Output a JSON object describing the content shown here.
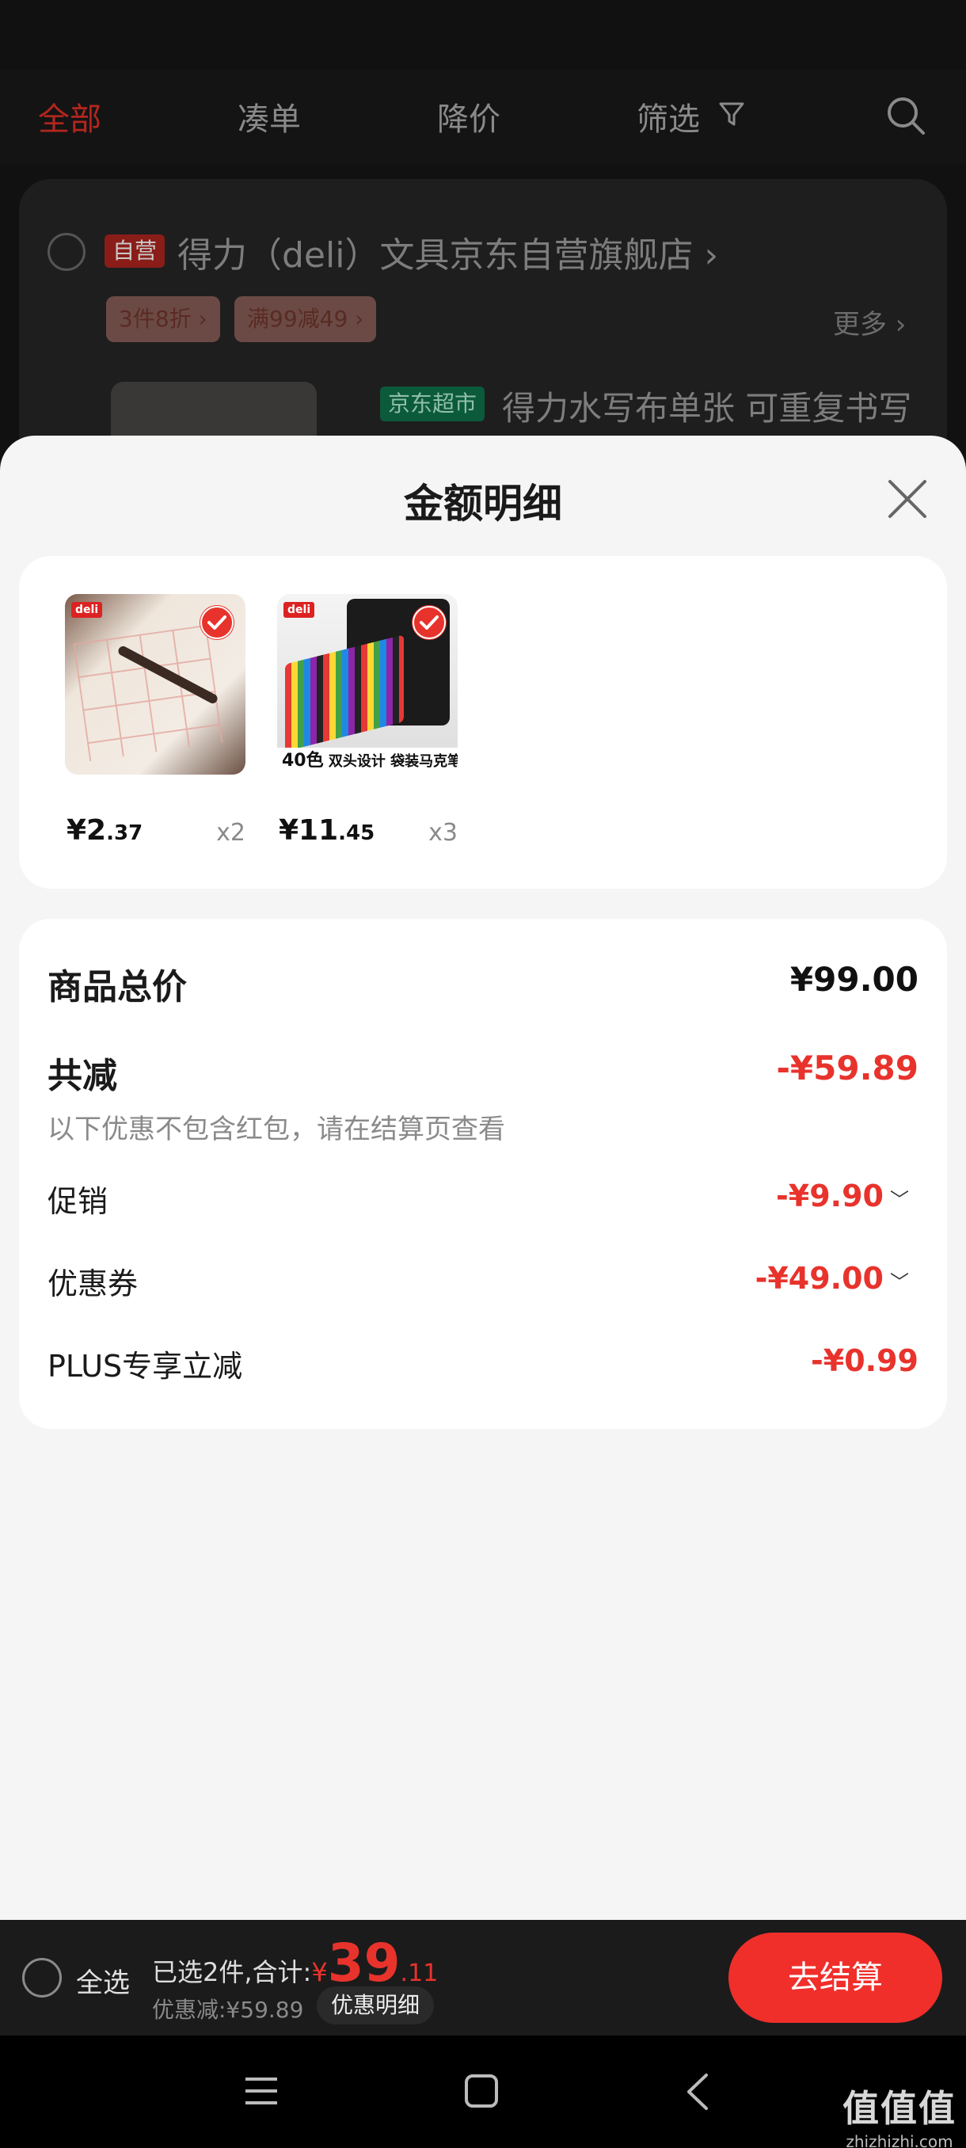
{
  "tabs": {
    "all": "全部",
    "bundle": "凑单",
    "price_drop": "降价",
    "filter": "筛选"
  },
  "shop": {
    "self_badge": "自营",
    "name": "得力（deli）文具京东自营旗舰店",
    "promo_1": "3件8折",
    "promo_2": "满99减49",
    "more": "更多",
    "market_badge": "京东超市",
    "product_name": "得力水写布单张 可重复书写"
  },
  "sheet": {
    "title": "金额明细"
  },
  "items": [
    {
      "brand": "deli",
      "price_int": "¥2",
      "price_dec": ".37",
      "qty": "x2"
    },
    {
      "brand": "deli",
      "price_int": "¥11",
      "price_dec": ".45",
      "qty": "x3",
      "caption_count": "40色",
      "caption_text": "双头设计 袋装马克笔"
    }
  ],
  "summary": {
    "total_label": "商品总价",
    "total_value": "¥99.00",
    "saved_label": "共减",
    "saved_value": "-¥59.89",
    "note": "以下优惠不包含红包，请在结算页查看",
    "promo_label": "促销",
    "promo_value": "-¥9.90",
    "coupon_label": "优惠券",
    "coupon_value": "-¥49.00",
    "plus_label": "PLUS专享立减",
    "plus_value": "-¥0.99"
  },
  "checkout": {
    "select_all": "全选",
    "selected_text": "已选2件,合计:",
    "sum_yen": "¥",
    "sum_int": "39",
    "sum_dec": ".11",
    "discount": "优惠减:¥59.89",
    "detail_button": "优惠明细",
    "checkout_button": "去结算"
  },
  "watermark": {
    "main": "值值值",
    "sub": "zhizhizhi.com"
  },
  "colors": {
    "accent_red": "#e8332c",
    "checkout_red": "#f02f2b",
    "sheet_bg": "#f5f5f5"
  }
}
